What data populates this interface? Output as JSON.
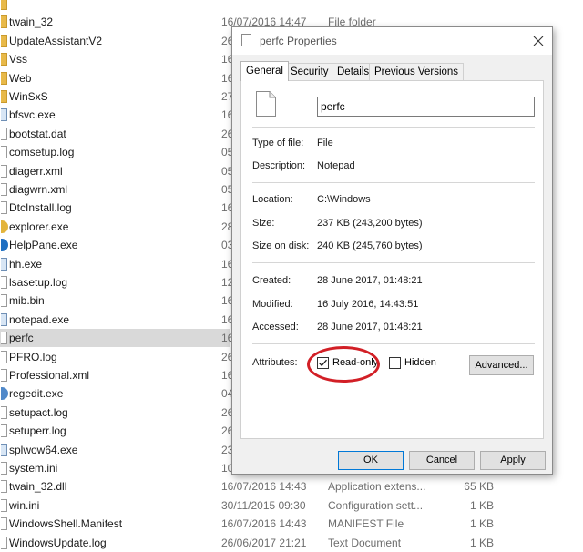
{
  "file_list": [
    {
      "name": "",
      "date": "",
      "type": "",
      "size": "",
      "icon": "folder-icon"
    },
    {
      "name": "twain_32",
      "date": "16/07/2016 14:47",
      "type": "File folder",
      "size": "",
      "icon": "folder-icon"
    },
    {
      "name": "UpdateAssistantV2",
      "date": "26",
      "type": "",
      "size": "",
      "icon": "folder-icon"
    },
    {
      "name": "Vss",
      "date": "16",
      "type": "",
      "size": "",
      "icon": "folder-icon"
    },
    {
      "name": "Web",
      "date": "16",
      "type": "",
      "size": "",
      "icon": "folder-icon"
    },
    {
      "name": "WinSxS",
      "date": "27",
      "type": "",
      "size": "",
      "icon": "folder-icon"
    },
    {
      "name": "bfsvc.exe",
      "date": "16",
      "type": "",
      "size": "",
      "icon": "exe-icon"
    },
    {
      "name": "bootstat.dat",
      "date": "26",
      "type": "",
      "size": "",
      "icon": "file-icon"
    },
    {
      "name": "comsetup.log",
      "date": "05",
      "type": "",
      "size": "",
      "icon": "file-icon"
    },
    {
      "name": "diagerr.xml",
      "date": "05",
      "type": "",
      "size": "",
      "icon": "file-icon"
    },
    {
      "name": "diagwrn.xml",
      "date": "05",
      "type": "",
      "size": "",
      "icon": "file-icon"
    },
    {
      "name": "DtcInstall.log",
      "date": "16",
      "type": "",
      "size": "",
      "icon": "file-icon"
    },
    {
      "name": "explorer.exe",
      "date": "28",
      "type": "",
      "size": "",
      "icon": "explorer-icon"
    },
    {
      "name": "HelpPane.exe",
      "date": "03",
      "type": "",
      "size": "",
      "icon": "help-icon"
    },
    {
      "name": "hh.exe",
      "date": "16",
      "type": "",
      "size": "",
      "icon": "exe-icon"
    },
    {
      "name": "lsasetup.log",
      "date": "12",
      "type": "",
      "size": "",
      "icon": "file-icon"
    },
    {
      "name": "mib.bin",
      "date": "16",
      "type": "",
      "size": "",
      "icon": "file-icon"
    },
    {
      "name": "notepad.exe",
      "date": "16",
      "type": "",
      "size": "",
      "icon": "exe-icon"
    },
    {
      "name": "perfc",
      "date": "16",
      "type": "",
      "size": "",
      "icon": "file-icon",
      "selected": true
    },
    {
      "name": "PFRO.log",
      "date": "26",
      "type": "",
      "size": "",
      "icon": "file-icon"
    },
    {
      "name": "Professional.xml",
      "date": "16",
      "type": "",
      "size": "",
      "icon": "file-icon"
    },
    {
      "name": "regedit.exe",
      "date": "04",
      "type": "",
      "size": "",
      "icon": "regedit-icon"
    },
    {
      "name": "setupact.log",
      "date": "26",
      "type": "",
      "size": "",
      "icon": "file-icon"
    },
    {
      "name": "setuperr.log",
      "date": "26",
      "type": "",
      "size": "",
      "icon": "file-icon"
    },
    {
      "name": "splwow64.exe",
      "date": "23",
      "type": "",
      "size": "",
      "icon": "exe-icon"
    },
    {
      "name": "system.ini",
      "date": "10",
      "type": "",
      "size": "",
      "icon": "file-icon"
    },
    {
      "name": "twain_32.dll",
      "date": "16/07/2016 14:43",
      "type": "Application extens...",
      "size": "65 KB",
      "icon": "file-icon"
    },
    {
      "name": "win.ini",
      "date": "30/11/2015 09:30",
      "type": "Configuration sett...",
      "size": "1 KB",
      "icon": "file-icon"
    },
    {
      "name": "WindowsShell.Manifest",
      "date": "16/07/2016 14:43",
      "type": "MANIFEST File",
      "size": "1 KB",
      "icon": "file-icon"
    },
    {
      "name": "WindowsUpdate.log",
      "date": "26/06/2017 21:21",
      "type": "Text Document",
      "size": "1 KB",
      "icon": "file-icon"
    }
  ],
  "dialog": {
    "title": "perfc Properties",
    "tabs": [
      "General",
      "Security",
      "Details",
      "Previous Versions"
    ],
    "active_tab": "General",
    "filename": "perfc",
    "labels": {
      "type": "Type of file:",
      "description": "Description:",
      "location": "Location:",
      "size": "Size:",
      "size_on_disk": "Size on disk:",
      "created": "Created:",
      "modified": "Modified:",
      "accessed": "Accessed:",
      "attributes": "Attributes:"
    },
    "values": {
      "type": "File",
      "description": "Notepad",
      "location": "C:\\Windows",
      "size": "237 KB (243,200 bytes)",
      "size_on_disk": "240 KB (245,760 bytes)",
      "created": "28 June 2017, 01:48:21",
      "modified": "16 July 2016, 14:43:51",
      "accessed": "28 June 2017, 01:48:21"
    },
    "readonly_label": "Read-only",
    "hidden_label": "Hidden",
    "readonly_checked": true,
    "hidden_checked": false,
    "advanced_label": "Advanced...",
    "ok_label": "OK",
    "cancel_label": "Cancel",
    "apply_label": "Apply",
    "highlight_color": "#d21f26"
  }
}
